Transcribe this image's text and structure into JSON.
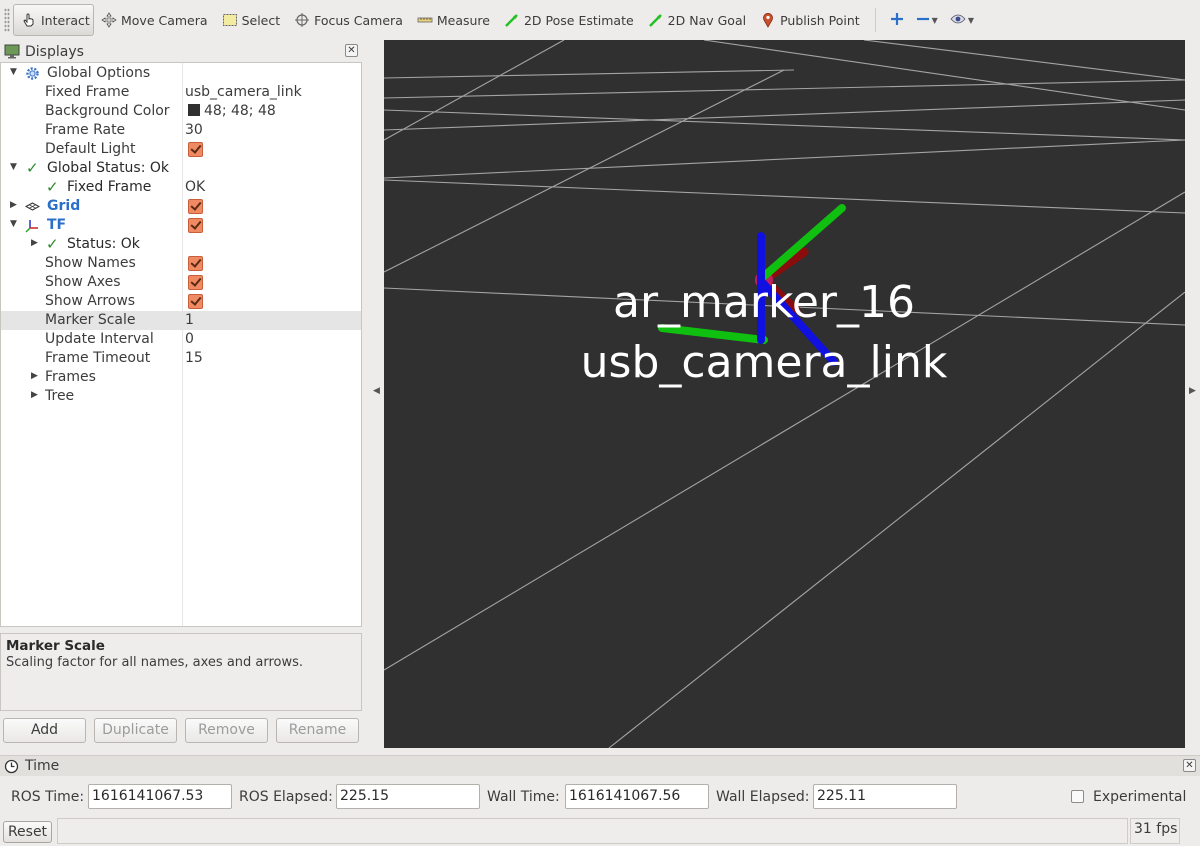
{
  "toolbar": {
    "tools": [
      {
        "label": "Interact",
        "icon": "hand-pointer-icon"
      },
      {
        "label": "Move Camera",
        "icon": "move-camera-icon"
      },
      {
        "label": "Select",
        "icon": "select-rectangle-icon"
      },
      {
        "label": "Focus Camera",
        "icon": "focus-camera-icon"
      },
      {
        "label": "Measure",
        "icon": "ruler-icon"
      },
      {
        "label": "2D Pose Estimate",
        "icon": "pose-arrow-icon"
      },
      {
        "label": "2D Nav Goal",
        "icon": "nav-goal-arrow-icon"
      },
      {
        "label": "Publish Point",
        "icon": "map-pin-icon"
      }
    ],
    "extra_icons": [
      "plus-icon",
      "minus-icon",
      "eye-icon"
    ]
  },
  "displays": {
    "title": "Displays",
    "rows": [
      {
        "name": "Global Options",
        "value": ""
      },
      {
        "name": "Fixed Frame",
        "value": "usb_camera_link"
      },
      {
        "name": "Background Color",
        "value": "48; 48; 48"
      },
      {
        "name": "Frame Rate",
        "value": "30"
      },
      {
        "name": "Default Light",
        "value": ""
      },
      {
        "name": "Global Status: Ok",
        "value": ""
      },
      {
        "name": "Fixed Frame",
        "value": "OK"
      },
      {
        "name": "Grid",
        "value": ""
      },
      {
        "name": "TF",
        "value": ""
      },
      {
        "name": "Status: Ok",
        "value": ""
      },
      {
        "name": "Show Names",
        "value": ""
      },
      {
        "name": "Show Axes",
        "value": ""
      },
      {
        "name": "Show Arrows",
        "value": ""
      },
      {
        "name": "Marker Scale",
        "value": "1"
      },
      {
        "name": "Update Interval",
        "value": "0"
      },
      {
        "name": "Frame Timeout",
        "value": "15"
      },
      {
        "name": "Frames",
        "value": ""
      },
      {
        "name": "Tree",
        "value": ""
      }
    ]
  },
  "description": {
    "title": "Marker Scale",
    "text": "Scaling factor for all names, axes and arrows."
  },
  "buttons": {
    "add": "Add",
    "duplicate": "Duplicate",
    "remove": "Remove",
    "rename": "Rename"
  },
  "viewport": {
    "background_color": "#303030",
    "frame_labels": [
      "ar_marker_16",
      "usb_camera_link"
    ]
  },
  "time": {
    "title": "Time",
    "ros_time_label": "ROS Time:",
    "ros_time": "1616141067.53",
    "ros_elapsed_label": "ROS Elapsed:",
    "ros_elapsed": "225.15",
    "wall_time_label": "Wall Time:",
    "wall_time": "1616141067.56",
    "wall_elapsed_label": "Wall Elapsed:",
    "wall_elapsed": "225.11",
    "experimental_label": "Experimental"
  },
  "status": {
    "reset": "Reset",
    "fps": "31 fps"
  },
  "colors": {
    "accent_blue": "#2a6fc9",
    "checkbox_orange": "#f08a62",
    "status_ok_green": "#2a8a2a",
    "axis_x_red": "#b01010",
    "axis_y_green": "#10c010",
    "axis_z_blue": "#1010e0"
  }
}
